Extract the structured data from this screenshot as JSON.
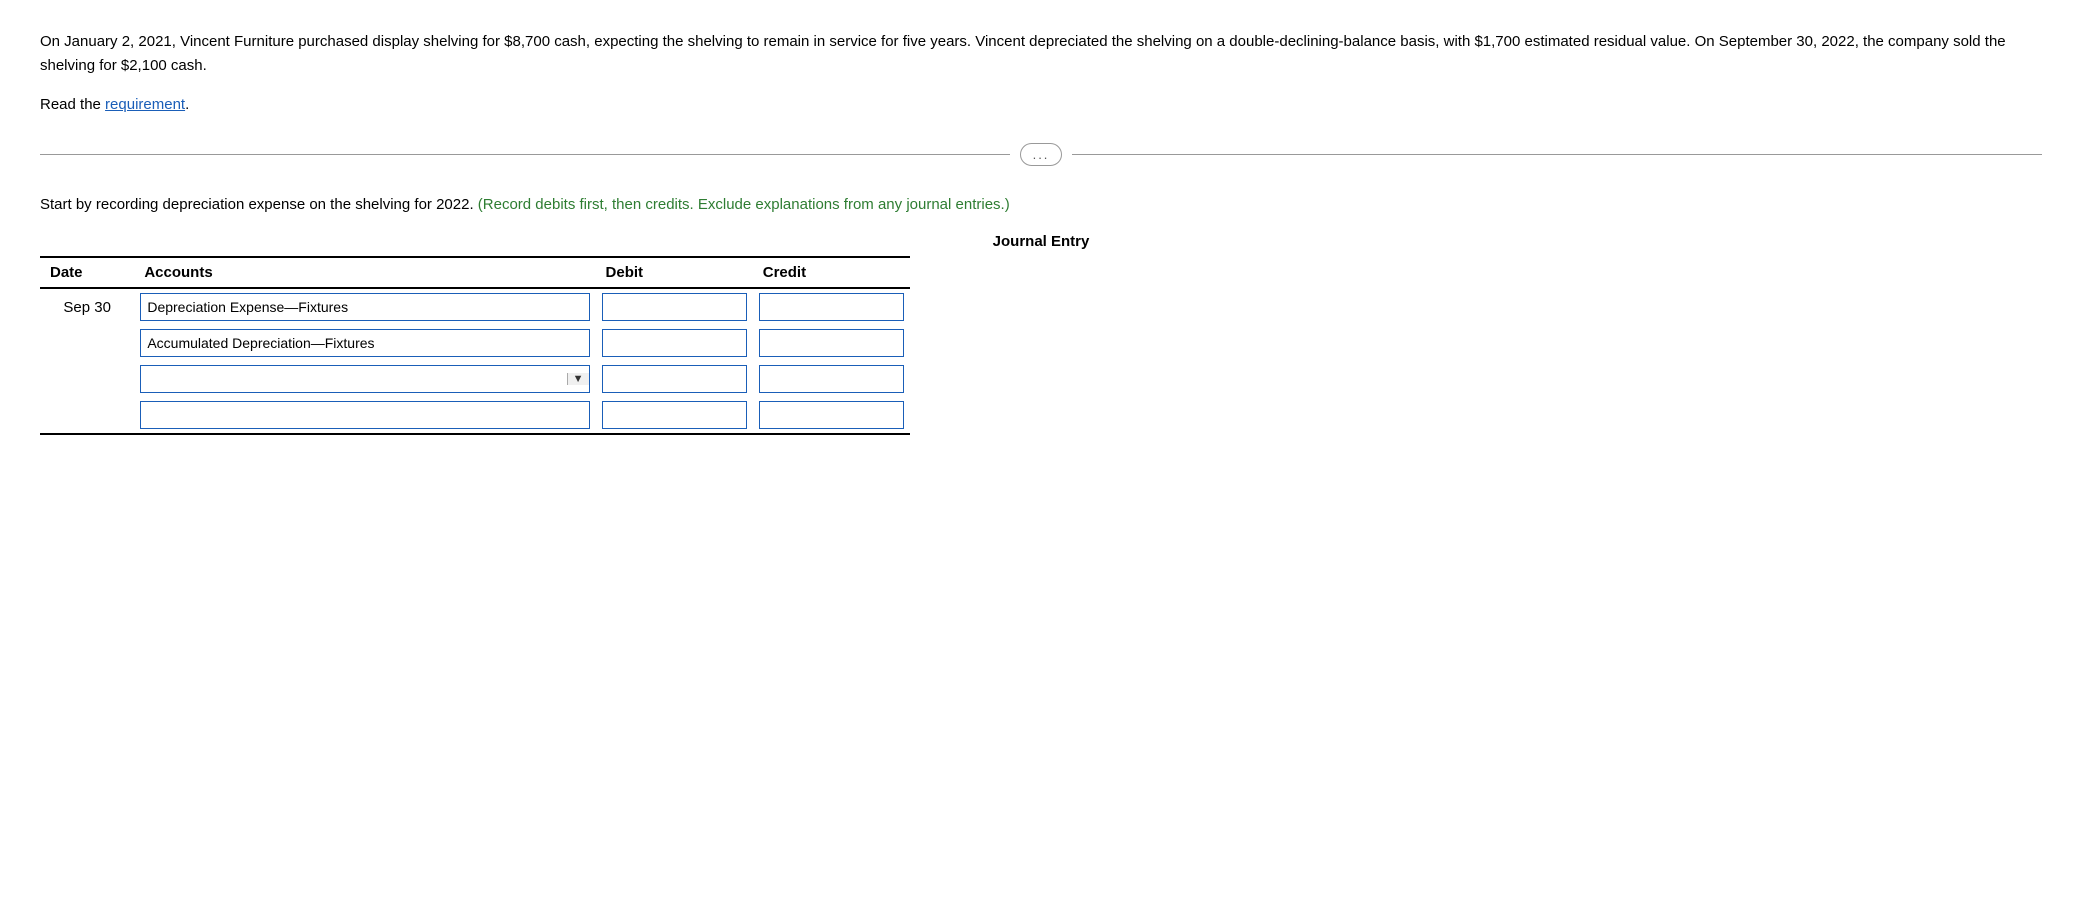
{
  "intro": {
    "text": "On January 2, 2021, Vincent Furniture purchased display shelving for $8,700 cash, expecting the shelving to remain in service for five years. Vincent depreciated the shelving on a double-declining-balance basis, with $1,700 estimated residual value. On September 30, 2022, the company sold the shelving for $2,100 cash."
  },
  "read_requirement": {
    "label": "Read the ",
    "link_text": "requirement",
    "period": "."
  },
  "divider": {
    "dots": "..."
  },
  "instruction": {
    "text_before": "Start by recording depreciation expense on the shelving for 2022. ",
    "green_text": "(Record debits first, then credits. Exclude explanations from any journal entries.)"
  },
  "journal": {
    "title": "Journal Entry",
    "headers": {
      "date": "Date",
      "accounts": "Accounts",
      "debit": "Debit",
      "credit": "Credit"
    },
    "rows": [
      {
        "date": "Sep 30",
        "account": "Depreciation Expense—Fixtures",
        "account_type": "text",
        "debit": "",
        "credit": ""
      },
      {
        "date": "",
        "account": "Accumulated Depreciation—Fixtures",
        "account_type": "text",
        "debit": "",
        "credit": ""
      },
      {
        "date": "",
        "account": "",
        "account_type": "dropdown",
        "debit": "",
        "credit": ""
      },
      {
        "date": "",
        "account": "",
        "account_type": "text",
        "debit": "",
        "credit": ""
      }
    ]
  }
}
